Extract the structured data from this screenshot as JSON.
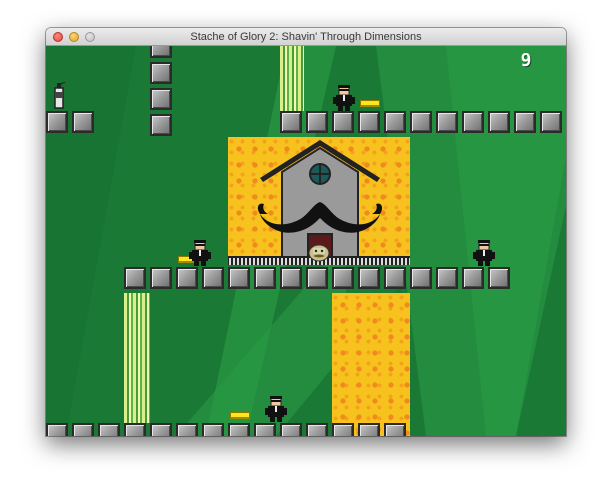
{
  "window": {
    "title": "Stache of Glory 2: Shavin' Through Dimensions"
  },
  "hud": {
    "score": "9"
  },
  "colors": {
    "grass_dark": "#1a7a35",
    "grass_light": "#2a9a45",
    "lava_base": "#f7c21d",
    "lava_spot": "#f08a1e",
    "gold": "#ffe61a",
    "stone": "#9c9c9c"
  },
  "sprites": {
    "player": "mustache-hero-icon",
    "enemy": "agent-in-black-suit-icon",
    "pickup": "gold-bar-icon",
    "item": "shaving-cream-can-icon"
  }
}
